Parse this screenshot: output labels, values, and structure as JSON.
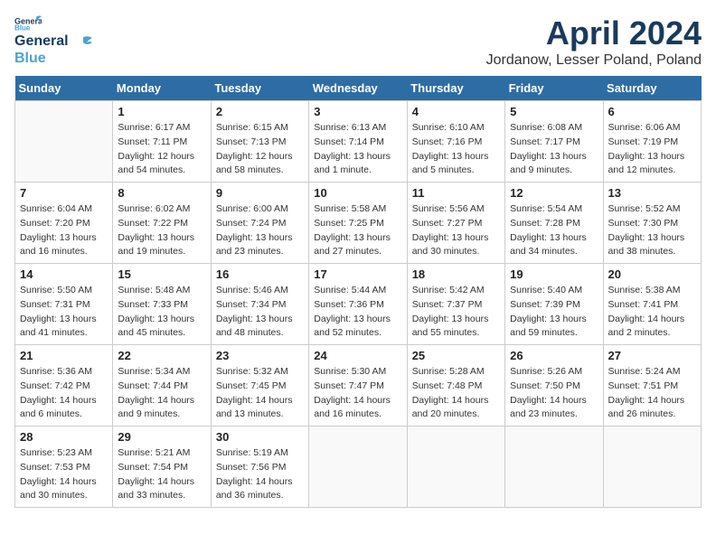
{
  "logo": {
    "line1": "General",
    "line2": "Blue"
  },
  "title": "April 2024",
  "location": "Jordanow, Lesser Poland, Poland",
  "days_header": [
    "Sunday",
    "Monday",
    "Tuesday",
    "Wednesday",
    "Thursday",
    "Friday",
    "Saturday"
  ],
  "weeks": [
    [
      {
        "num": "",
        "info": ""
      },
      {
        "num": "1",
        "info": "Sunrise: 6:17 AM\nSunset: 7:11 PM\nDaylight: 12 hours\nand 54 minutes."
      },
      {
        "num": "2",
        "info": "Sunrise: 6:15 AM\nSunset: 7:13 PM\nDaylight: 12 hours\nand 58 minutes."
      },
      {
        "num": "3",
        "info": "Sunrise: 6:13 AM\nSunset: 7:14 PM\nDaylight: 13 hours\nand 1 minute."
      },
      {
        "num": "4",
        "info": "Sunrise: 6:10 AM\nSunset: 7:16 PM\nDaylight: 13 hours\nand 5 minutes."
      },
      {
        "num": "5",
        "info": "Sunrise: 6:08 AM\nSunset: 7:17 PM\nDaylight: 13 hours\nand 9 minutes."
      },
      {
        "num": "6",
        "info": "Sunrise: 6:06 AM\nSunset: 7:19 PM\nDaylight: 13 hours\nand 12 minutes."
      }
    ],
    [
      {
        "num": "7",
        "info": "Sunrise: 6:04 AM\nSunset: 7:20 PM\nDaylight: 13 hours\nand 16 minutes."
      },
      {
        "num": "8",
        "info": "Sunrise: 6:02 AM\nSunset: 7:22 PM\nDaylight: 13 hours\nand 19 minutes."
      },
      {
        "num": "9",
        "info": "Sunrise: 6:00 AM\nSunset: 7:24 PM\nDaylight: 13 hours\nand 23 minutes."
      },
      {
        "num": "10",
        "info": "Sunrise: 5:58 AM\nSunset: 7:25 PM\nDaylight: 13 hours\nand 27 minutes."
      },
      {
        "num": "11",
        "info": "Sunrise: 5:56 AM\nSunset: 7:27 PM\nDaylight: 13 hours\nand 30 minutes."
      },
      {
        "num": "12",
        "info": "Sunrise: 5:54 AM\nSunset: 7:28 PM\nDaylight: 13 hours\nand 34 minutes."
      },
      {
        "num": "13",
        "info": "Sunrise: 5:52 AM\nSunset: 7:30 PM\nDaylight: 13 hours\nand 38 minutes."
      }
    ],
    [
      {
        "num": "14",
        "info": "Sunrise: 5:50 AM\nSunset: 7:31 PM\nDaylight: 13 hours\nand 41 minutes."
      },
      {
        "num": "15",
        "info": "Sunrise: 5:48 AM\nSunset: 7:33 PM\nDaylight: 13 hours\nand 45 minutes."
      },
      {
        "num": "16",
        "info": "Sunrise: 5:46 AM\nSunset: 7:34 PM\nDaylight: 13 hours\nand 48 minutes."
      },
      {
        "num": "17",
        "info": "Sunrise: 5:44 AM\nSunset: 7:36 PM\nDaylight: 13 hours\nand 52 minutes."
      },
      {
        "num": "18",
        "info": "Sunrise: 5:42 AM\nSunset: 7:37 PM\nDaylight: 13 hours\nand 55 minutes."
      },
      {
        "num": "19",
        "info": "Sunrise: 5:40 AM\nSunset: 7:39 PM\nDaylight: 13 hours\nand 59 minutes."
      },
      {
        "num": "20",
        "info": "Sunrise: 5:38 AM\nSunset: 7:41 PM\nDaylight: 14 hours\nand 2 minutes."
      }
    ],
    [
      {
        "num": "21",
        "info": "Sunrise: 5:36 AM\nSunset: 7:42 PM\nDaylight: 14 hours\nand 6 minutes."
      },
      {
        "num": "22",
        "info": "Sunrise: 5:34 AM\nSunset: 7:44 PM\nDaylight: 14 hours\nand 9 minutes."
      },
      {
        "num": "23",
        "info": "Sunrise: 5:32 AM\nSunset: 7:45 PM\nDaylight: 14 hours\nand 13 minutes."
      },
      {
        "num": "24",
        "info": "Sunrise: 5:30 AM\nSunset: 7:47 PM\nDaylight: 14 hours\nand 16 minutes."
      },
      {
        "num": "25",
        "info": "Sunrise: 5:28 AM\nSunset: 7:48 PM\nDaylight: 14 hours\nand 20 minutes."
      },
      {
        "num": "26",
        "info": "Sunrise: 5:26 AM\nSunset: 7:50 PM\nDaylight: 14 hours\nand 23 minutes."
      },
      {
        "num": "27",
        "info": "Sunrise: 5:24 AM\nSunset: 7:51 PM\nDaylight: 14 hours\nand 26 minutes."
      }
    ],
    [
      {
        "num": "28",
        "info": "Sunrise: 5:23 AM\nSunset: 7:53 PM\nDaylight: 14 hours\nand 30 minutes."
      },
      {
        "num": "29",
        "info": "Sunrise: 5:21 AM\nSunset: 7:54 PM\nDaylight: 14 hours\nand 33 minutes."
      },
      {
        "num": "30",
        "info": "Sunrise: 5:19 AM\nSunset: 7:56 PM\nDaylight: 14 hours\nand 36 minutes."
      },
      {
        "num": "",
        "info": ""
      },
      {
        "num": "",
        "info": ""
      },
      {
        "num": "",
        "info": ""
      },
      {
        "num": "",
        "info": ""
      }
    ]
  ]
}
